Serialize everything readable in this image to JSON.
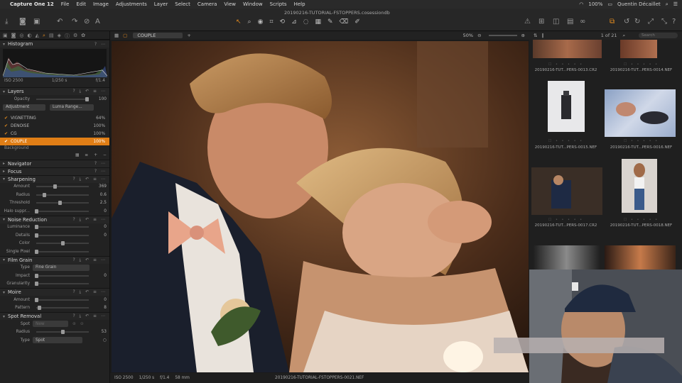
{
  "menubar": {
    "app_name": "Capture One 12",
    "menus": [
      "File",
      "Edit",
      "Image",
      "Adjustments",
      "Layer",
      "Select",
      "Camera",
      "View",
      "Window",
      "Scripts",
      "Help"
    ],
    "battery": "100%",
    "user": "Quentin Décaillet"
  },
  "toolbar": {
    "session_name": "20190216-TUTORIAL-FSTOPPERS.cosessiondb"
  },
  "left": {
    "histogram": {
      "title": "Histogram",
      "iso": "ISO 2500",
      "shutter": "1/250 s",
      "aperture": "f/1.4"
    },
    "layers": {
      "title": "Layers",
      "opacity_label": "Opacity",
      "opacity_value": "100",
      "opacity_level": 1.0,
      "adjustment_label": "Adjustment",
      "luma_label": "Luma Range...",
      "items": [
        {
          "name": "VIGNETTING",
          "pct": "64%"
        },
        {
          "name": "DENOISE",
          "pct": "100%"
        },
        {
          "name": "CG",
          "pct": "100%"
        },
        {
          "name": "COUPLE",
          "pct": "100%"
        }
      ],
      "background_label": "Background"
    },
    "navigator_title": "Navigator",
    "focus_title": "Focus",
    "sharpening": {
      "title": "Sharpening",
      "rows": [
        {
          "label": "Amount",
          "value": "369",
          "level": 0.35
        },
        {
          "label": "Radius",
          "value": "0.6",
          "level": 0.15
        },
        {
          "label": "Threshold",
          "value": "2.5",
          "level": 0.45
        },
        {
          "label": "Halo suppr...",
          "value": "0",
          "level": 0.0
        }
      ]
    },
    "noise": {
      "title": "Noise Reduction",
      "rows": [
        {
          "label": "Luminance",
          "value": "0",
          "level": 0.0
        },
        {
          "label": "Details",
          "value": "0",
          "level": 0.0
        },
        {
          "label": "Color",
          "value": "",
          "level": 0.5
        },
        {
          "label": "Single Pixel",
          "value": "",
          "level": 0.0
        }
      ]
    },
    "grain": {
      "title": "Film Grain",
      "type_label": "Type",
      "type_value": "Fine Grain",
      "rows": [
        {
          "label": "Impact",
          "value": "0",
          "level": 0.0
        },
        {
          "label": "Granularity",
          "value": "",
          "level": 0.0
        }
      ]
    },
    "moire": {
      "title": "Moire",
      "rows": [
        {
          "label": "Amount",
          "value": "0",
          "level": 0.0
        },
        {
          "label": "Pattern",
          "value": "8",
          "level": 0.05
        }
      ]
    },
    "spot": {
      "title": "Spot Removal",
      "spot_label": "Spot",
      "spot_value": "New",
      "radius_label": "Radius",
      "radius_value": "53",
      "radius_level": 0.5,
      "type_label": "Type",
      "type_value": "Spot"
    }
  },
  "viewer": {
    "layer_selector": "COUPLE",
    "zoom": "50%",
    "iso": "ISO 2500",
    "shutter": "1/250 s",
    "aperture": "f/1.4",
    "focal": "58 mm",
    "filename": "20190216-TUTORIAL-FSTOPPERS-0021.NEF"
  },
  "browser": {
    "count": "1 of 21",
    "search_placeholder": "Search",
    "thumbs": [
      {
        "label": "20190216-TUT...PERS-0013.CR2"
      },
      {
        "label": "20190216-TUT...PERS-0014.NEF"
      },
      {
        "label": "20190216-TUT...PERS-0015.NEF"
      },
      {
        "label": "20190216-TUT...PERS-0016.NEF"
      },
      {
        "label": "20190216-TUT...PERS-0017.CR2"
      },
      {
        "label": "20190216-TUT...PERS-0018.NEF"
      }
    ]
  },
  "colors": {
    "accent": "#e07e16",
    "panel": "#222222"
  }
}
